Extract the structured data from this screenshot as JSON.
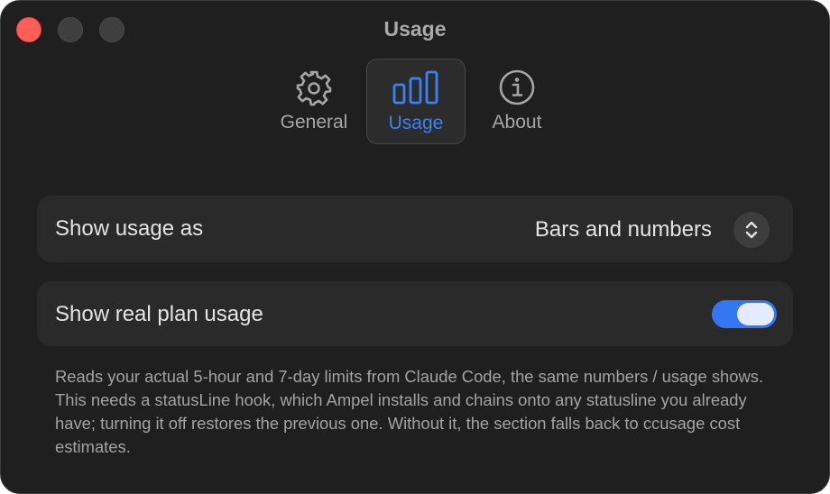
{
  "window": {
    "title": "Usage"
  },
  "tabs": {
    "general": {
      "label": "General",
      "icon": "gear-icon"
    },
    "usage": {
      "label": "Usage",
      "icon": "bar-chart-icon",
      "selected": true
    },
    "about": {
      "label": "About",
      "icon": "info-icon"
    }
  },
  "settings": {
    "show_usage_as": {
      "label": "Show usage as",
      "value": "Bars and numbers"
    },
    "show_real_plan_usage": {
      "label": "Show real plan usage",
      "enabled": true
    },
    "description": "Reads your actual 5-hour and 7-day limits from Claude Code, the same numbers / usage shows. This needs a statusLine hook, which Ampel installs and chains onto any statusline you already have; turning it off restores the previous one. Without it, the section falls back to ccusage cost estimates."
  },
  "colors": {
    "accent": "#3d82f2",
    "toggle_on": "#3477f5",
    "close_button": "#fe5f57",
    "window_background": "#1f1f1f",
    "row_background": "#2a2a2a"
  }
}
